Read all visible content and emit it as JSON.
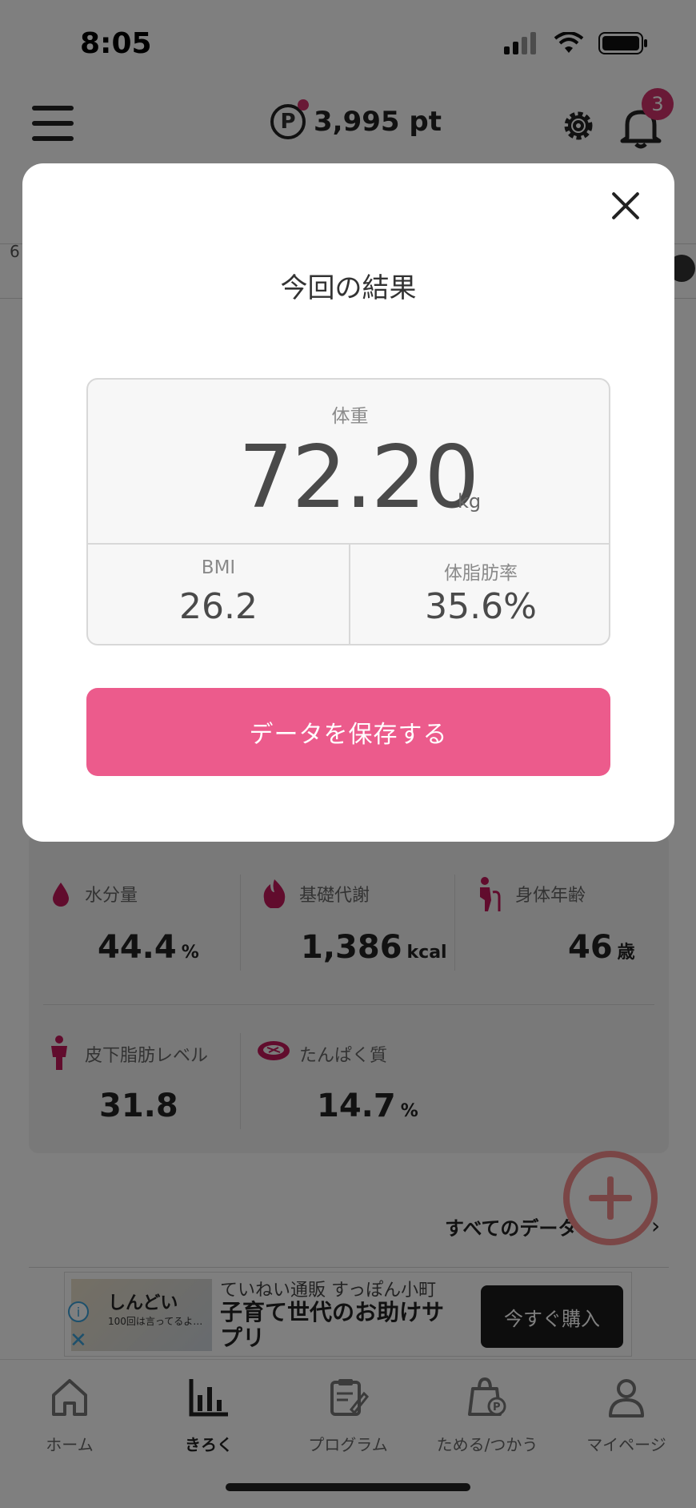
{
  "status_bar": {
    "time": "8:05"
  },
  "header": {
    "points": "3,995 pt",
    "points_symbol": "P",
    "notification_count": "3"
  },
  "background": {
    "edge_number": "6"
  },
  "metrics": [
    {
      "icon": "water-drop-icon",
      "label": "水分量",
      "value": "44.4",
      "unit": "%"
    },
    {
      "icon": "flame-icon",
      "label": "基礎代謝",
      "value": "1,386",
      "unit": "kcal"
    },
    {
      "icon": "elderly-person-icon",
      "label": "身体年齢",
      "value": "46",
      "unit": "歳"
    },
    {
      "icon": "person-icon",
      "label": "皮下脂肪レベル",
      "value": "31.8",
      "unit": ""
    },
    {
      "icon": "meat-icon",
      "label": "たんぱく質",
      "value": "14.7",
      "unit": "%"
    }
  ],
  "all_data_link": "すべてのデータ",
  "ad": {
    "thumb_title": "しんどい",
    "thumb_sub": "100回は言ってるよ…",
    "shop": "ていねい通販 すっぽん小町",
    "headline": "子育て世代のお助けサプリ",
    "buy_label": "今すぐ購入"
  },
  "tabs": [
    {
      "icon": "home-icon",
      "label": "ホーム",
      "active": false
    },
    {
      "icon": "bar-chart-icon",
      "label": "きろく",
      "active": true
    },
    {
      "icon": "clipboard-icon",
      "label": "プログラム",
      "active": false
    },
    {
      "icon": "points-bag-icon",
      "label": "ためる/つかう",
      "active": false
    },
    {
      "icon": "user-icon",
      "label": "マイページ",
      "active": false
    }
  ],
  "modal": {
    "title": "今回の結果",
    "weight_label": "体重",
    "weight_value": "72.20",
    "weight_unit": "kg",
    "bmi_label": "BMI",
    "bmi_value": "26.2",
    "fat_label": "体脂肪率",
    "fat_value": "35.6%",
    "save_label": "データを保存する"
  },
  "colors": {
    "accent": "#ec5b8c",
    "badge": "#d2336c",
    "metric_icon": "#c2185b"
  }
}
